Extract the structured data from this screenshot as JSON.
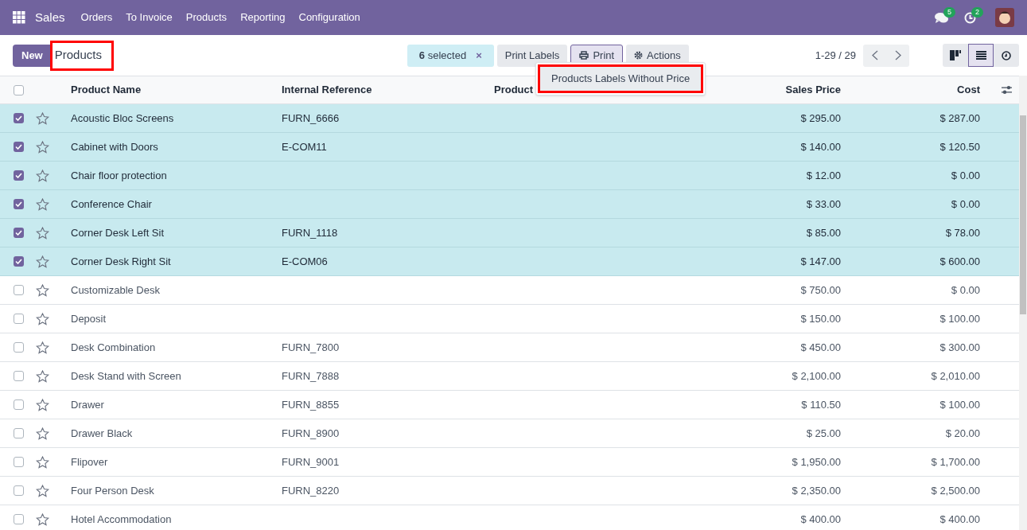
{
  "navbar": {
    "app": "Sales",
    "menu": [
      "Orders",
      "To Invoice",
      "Products",
      "Reporting",
      "Configuration"
    ],
    "messages_count": "5",
    "activities_count": "2"
  },
  "control_panel": {
    "new_button": "New",
    "breadcrumb": "Products",
    "selection": {
      "count": "6",
      "label": "selected",
      "clear": "×"
    },
    "buttons": [
      "Print Labels",
      "Print",
      "Actions"
    ],
    "print_menu": {
      "open": true,
      "items": [
        "Products Labels Without Price"
      ]
    },
    "pager": "1-29 / 29",
    "views": [
      {
        "kind": "kanban",
        "selected": false
      },
      {
        "kind": "list",
        "selected": true
      },
      {
        "kind": "activity",
        "selected": false
      }
    ]
  },
  "table": {
    "all_checked": false,
    "columns": [
      "Product Name",
      "Internal Reference",
      "Product",
      "Sales Price",
      "Cost"
    ],
    "rows": [
      {
        "name": "Acoustic Bloc Screens",
        "reference": "FURN_6666",
        "sales_price": "$ 295.00",
        "cost": "$ 287.00",
        "selected": true
      },
      {
        "name": "Cabinet with Doors",
        "reference": "E-COM11",
        "sales_price": "$ 140.00",
        "cost": "$ 120.50",
        "selected": true
      },
      {
        "name": "Chair floor protection",
        "reference": "",
        "sales_price": "$ 12.00",
        "cost": "$ 0.00",
        "selected": true
      },
      {
        "name": "Conference Chair",
        "reference": "",
        "sales_price": "$ 33.00",
        "cost": "$ 0.00",
        "selected": true
      },
      {
        "name": "Corner Desk Left Sit",
        "reference": "FURN_1118",
        "sales_price": "$ 85.00",
        "cost": "$ 78.00",
        "selected": true
      },
      {
        "name": "Corner Desk Right Sit",
        "reference": "E-COM06",
        "sales_price": "$ 147.00",
        "cost": "$ 600.00",
        "selected": true
      },
      {
        "name": "Customizable Desk",
        "reference": "",
        "sales_price": "$ 750.00",
        "cost": "$ 0.00",
        "selected": false
      },
      {
        "name": "Deposit",
        "reference": "",
        "sales_price": "$ 150.00",
        "cost": "$ 100.00",
        "selected": false
      },
      {
        "name": "Desk Combination",
        "reference": "FURN_7800",
        "sales_price": "$ 450.00",
        "cost": "$ 300.00",
        "selected": false
      },
      {
        "name": "Desk Stand with Screen",
        "reference": "FURN_7888",
        "sales_price": "$ 2,100.00",
        "cost": "$ 2,010.00",
        "selected": false
      },
      {
        "name": "Drawer",
        "reference": "FURN_8855",
        "sales_price": "$ 110.50",
        "cost": "$ 100.00",
        "selected": false
      },
      {
        "name": "Drawer Black",
        "reference": "FURN_8900",
        "sales_price": "$ 25.00",
        "cost": "$ 20.00",
        "selected": false
      },
      {
        "name": "Flipover",
        "reference": "FURN_9001",
        "sales_price": "$ 1,950.00",
        "cost": "$ 1,700.00",
        "selected": false
      },
      {
        "name": "Four Person Desk",
        "reference": "FURN_8220",
        "sales_price": "$ 2,350.00",
        "cost": "$ 2,500.00",
        "selected": false
      },
      {
        "name": "Hotel Accommodation",
        "reference": "",
        "sales_price": "$ 400.00",
        "cost": "$ 400.00",
        "selected": false
      }
    ]
  }
}
